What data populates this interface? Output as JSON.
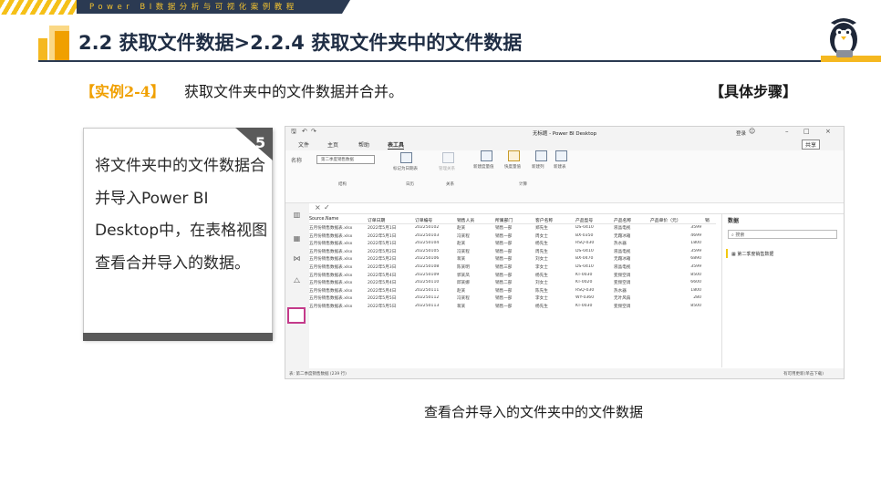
{
  "banner": {
    "text": "Power BI数据分析与可视化案例教程"
  },
  "header": {
    "title": "2.2 获取文件数据>2.2.4 获取文件夹中的文件数据"
  },
  "example": {
    "tag": "【实例2-4】",
    "description": "获取文件夹中的文件数据并合并。",
    "steps_label": "【具体步骤】"
  },
  "card": {
    "step_number": "5",
    "text": "将文件夹中的文件数据合并导入Power BI Desktop中，在表格视图查看合并导入的数据。"
  },
  "caption": "查看合并导入的文件夹中的文件数据",
  "pbi": {
    "window_title": "无标题 - Power BI Desktop",
    "signin": "登录",
    "menu": [
      "文件",
      "主页",
      "帮助",
      "表工具"
    ],
    "share": "共享",
    "name_label": "名称",
    "name_value": "第二季度销售数据",
    "ribbon_buttons": [
      "标记为日期表",
      "管理关系",
      "新建度量值",
      "快度量值",
      "新建列",
      "新建表"
    ],
    "ribbon_groups": [
      "结构",
      "日历",
      "关系",
      "计算"
    ],
    "data_panel_title": "数据",
    "search_placeholder": "搜索",
    "data_table": "第二季度销售数据",
    "columns": [
      "Source.Name",
      "订单日期",
      "订单编号",
      "销售人员",
      "所属部门",
      "客户名称",
      "产品型号",
      "产品名称",
      "产品单价（元）",
      "销"
    ],
    "rows": [
      [
        "五月份销售数据表.xlsx",
        "2022年5月1日",
        "202250102",
        "赵某",
        "销售一部",
        "郑先生",
        "DS-0410",
        "液晶电视",
        "3599"
      ],
      [
        "五月份销售数据表.xlsx",
        "2022年5月1日",
        "202250103",
        "冯某程",
        "销售一部",
        "周女士",
        "BX-0350",
        "无霜冰箱",
        "4699"
      ],
      [
        "五月份销售数据表.xlsx",
        "2022年5月1日",
        "202250104",
        "赵某",
        "销售一部",
        "杨先生",
        "RSQ-030",
        "热水器",
        "1800"
      ],
      [
        "五月份销售数据表.xlsx",
        "2022年5月2日",
        "202250105",
        "冯某程",
        "销售一部",
        "周先生",
        "DS-0410",
        "液晶电视",
        "3599"
      ],
      [
        "五月份销售数据表.xlsx",
        "2022年5月2日",
        "202250106",
        "蒋某",
        "销售一部",
        "刘女士",
        "BX-0470",
        "无霜冰箱",
        "6890"
      ],
      [
        "五月份销售数据表.xlsx",
        "2022年5月3日",
        "202250108",
        "陈某明",
        "销售三部",
        "李女士",
        "DS-0410",
        "液晶电视",
        "3599"
      ],
      [
        "五月份销售数据表.xlsx",
        "2022年5月4日",
        "202250109",
        "郭某凤",
        "销售一部",
        "杨先生",
        "KT-0030",
        "变频空调",
        "8500"
      ],
      [
        "五月份销售数据表.xlsx",
        "2022年5月4日",
        "202250110",
        "邱某娜",
        "销售二部",
        "刘女士",
        "KT-0020",
        "变频空调",
        "6600"
      ],
      [
        "五月份销售数据表.xlsx",
        "2022年5月4日",
        "202250111",
        "赵某",
        "销售一部",
        "陈先生",
        "RSQ-030",
        "热水器",
        "1800"
      ],
      [
        "五月份销售数据表.xlsx",
        "2022年5月5日",
        "202250112",
        "冯某程",
        "销售一部",
        "李女士",
        "WY-0360",
        "无叶风扇",
        "280"
      ],
      [
        "五月份销售数据表.xlsx",
        "2022年5月5日",
        "202250113",
        "蒋某",
        "销售一部",
        "杨先生",
        "KT-0030",
        "变频空调",
        "8500"
      ]
    ],
    "status_left": "表: 第二季度销售数据 (239 行)",
    "status_right": "有可用更新(单击下载)"
  }
}
